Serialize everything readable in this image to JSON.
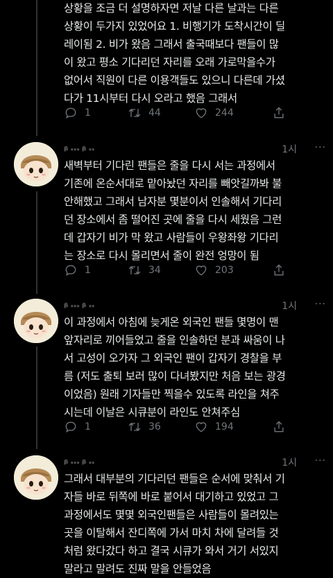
{
  "tweets": [
    {
      "name": "",
      "time": "",
      "text": "상황을 조금 더 설명하자면 저날 다른 날과는 다른\n상황이 두가지 있었어요 1. 비행기가 도착시간이 딜\n레이됨 2. 비가 왔음 그래서 출국때보다 팬들이 많\n이 왔고 평소 기다리던 자리를 오래 가로막을수가\n없어서 직원이 다른 이용객들도 있으니 다른데 가셨\n다가 11시부터 다시 오라고 했음 그래서",
      "reply_count": "1",
      "retweet_count": "44",
      "like_count": "244"
    },
    {
      "name": "ᵦ ... ᵦ ..",
      "time": "1시",
      "text": "새벽부터 기다린 팬들은 줄을 다시 서는 과정에서\n기존에 온순서대로 맡아놨던 자리를 빼앗길까봐 불\n안해했고 그래서 남자분 몇분이서 인솔해서 기다리\n던 장소에서 좀 떨어진 곳에 줄을 다시 세웠음 그런\n데 갑자기 비가 막 왔고 사람들이 우왕좌왕 기다리\n는 장소로 다시 몰리면서 줄이 완전 엉망이 됨",
      "reply_count": "1",
      "retweet_count": "34",
      "like_count": "203"
    },
    {
      "name": "ᵦ ... ᵦ ..",
      "time": "1시",
      "text": "이 과정에서 아침에 늦게온 외국인 팬들 몇명이 맨\n앞자리로 끼어들었고 줄을 인솔하던 분과 싸움이 나\n서 고성이 오가자 그 외국인 팬이 갑자기 경찰을 부\n름 (저도 출퇴 보러 많이 다녀봤지만 처음 보는 광경\n이었음) 원래 기자들만 찍을수 있도록 라인을 쳐주\n시는데 이날은 시큐분이 라인도 안쳐주심",
      "reply_count": "1",
      "retweet_count": "36",
      "like_count": "194"
    },
    {
      "name": "ᵦ ... ᵦ ..",
      "time": "1시",
      "text": "그래서 대부분의 기다리던 팬들은 순서에 맞춰서 기\n자들 바로 뒤쪽에 바로 붙어서 대기하고 있었고 그\n과정에서도 몇몇 외국인팬들은 사람들이 몰려있는\n곳을 이탈해서 잔디쪽에 가서 마치 차에 달려들 것\n처럼 왔다갔다 하고 결국 시큐가 와서 거기 서있지\n말라고 말려도 진짜 말을 안들었음",
      "reply_count": "",
      "retweet_count": "",
      "like_count": ""
    }
  ],
  "more_label": "···"
}
